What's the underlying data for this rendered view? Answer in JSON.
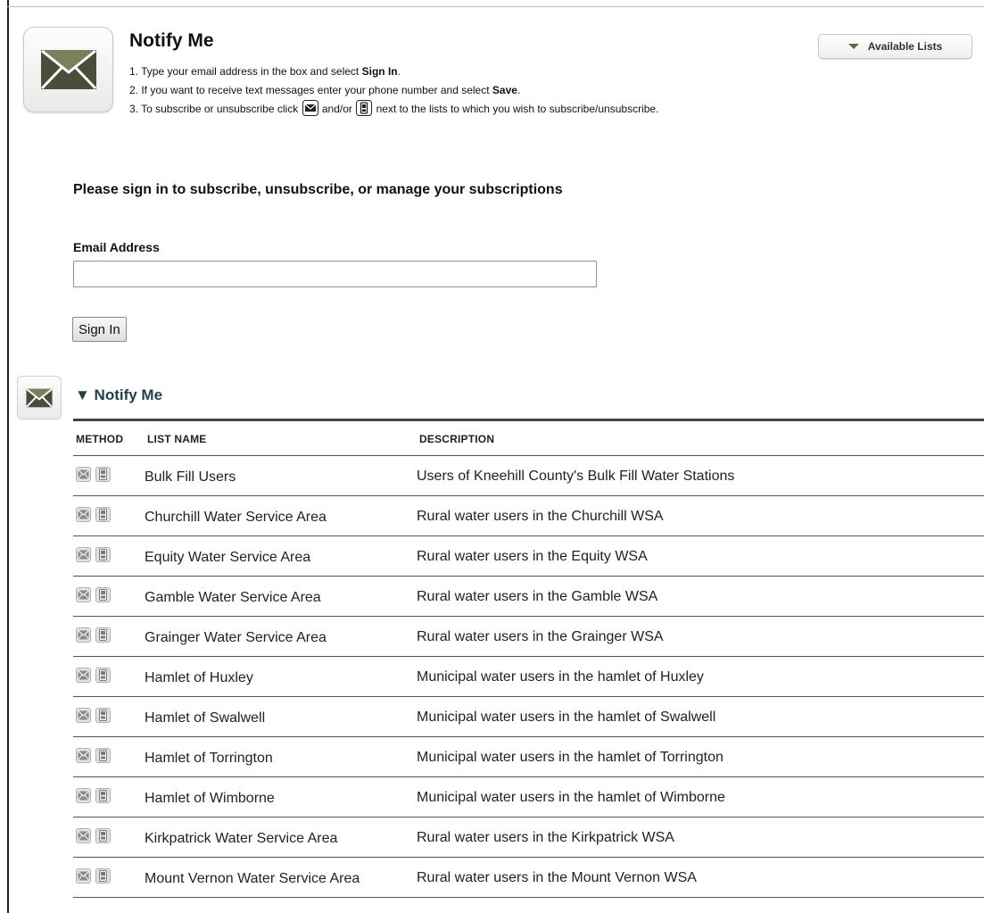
{
  "header": {
    "title": "Notify Me",
    "step1_pre": "1. Type your email address in the box and select ",
    "step1_bold": "Sign In",
    "step1_post": ".",
    "step2_pre": "2. If you want to receive text messages enter your phone number and select ",
    "step2_bold": "Save",
    "step2_post": ".",
    "step3_pre": "3. To subscribe or unsubscribe click ",
    "step3_mid": " and/or ",
    "step3_post": " next to the lists to which you wish to subscribe/unsubscribe.",
    "available_lists_label": "Available Lists"
  },
  "signin": {
    "heading": "Please sign in to subscribe, unsubscribe, or manage your subscriptions",
    "email_label": "Email Address",
    "email_value": "",
    "button_label": "Sign In"
  },
  "section": {
    "title": "▼ Notify Me",
    "columns": {
      "method": "METHOD",
      "list_name": "LIST NAME",
      "description": "DESCRIPTION"
    },
    "rows": [
      {
        "name": "Bulk Fill Users",
        "description": "Users of Kneehill County's Bulk Fill Water Stations"
      },
      {
        "name": "Churchill Water Service Area",
        "description": "Rural water users in the Churchill WSA"
      },
      {
        "name": "Equity Water Service Area",
        "description": "Rural water users in the Equity WSA"
      },
      {
        "name": "Gamble Water Service Area",
        "description": "Rural water users in the Gamble WSA"
      },
      {
        "name": "Grainger Water Service Area",
        "description": "Rural water users in the Grainger WSA"
      },
      {
        "name": "Hamlet of Huxley",
        "description": "Municipal water users in the hamlet of Huxley"
      },
      {
        "name": "Hamlet of Swalwell",
        "description": "Municipal water users in the hamlet of Swalwell"
      },
      {
        "name": "Hamlet of Torrington",
        "description": "Municipal water users in the hamlet of Torrington"
      },
      {
        "name": "Hamlet of Wimborne",
        "description": "Municipal water users in the hamlet of Wimborne"
      },
      {
        "name": "Kirkpatrick Water Service Area",
        "description": "Rural water users in the Kirkpatrick WSA"
      },
      {
        "name": "Mount Vernon Water Service Area",
        "description": "Rural water users in the Mount Vernon WSA"
      }
    ]
  },
  "colors": {
    "envelope_dark": "#4a4d3a",
    "envelope_light": "#ffffff",
    "section_title": "#233f45"
  },
  "icons": {
    "header": "envelope-icon",
    "section": "envelope-icon",
    "row_email": "email-subscribe-icon",
    "row_sms": "phone-subscribe-icon"
  }
}
